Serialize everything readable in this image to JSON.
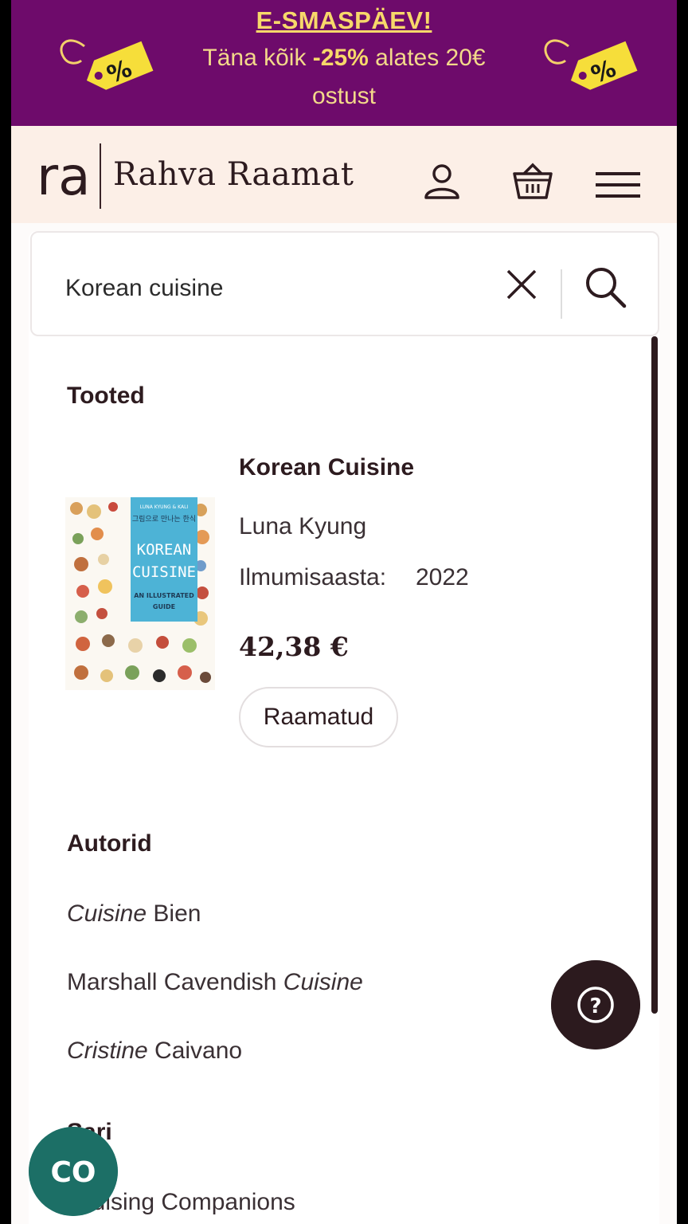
{
  "promo": {
    "title": "E-SMASPÄEV!",
    "line1_pre": "Täna kõik ",
    "line1_bold": "-25%",
    "line1_post": " alates 20€",
    "line2": "ostust",
    "tag_symbol": "%"
  },
  "header": {
    "logo_mark": "ra",
    "logo_text": "Rahva Raamat",
    "icons": [
      "user-icon",
      "basket-icon",
      "menu-icon"
    ]
  },
  "search": {
    "value": "Korean cuisine",
    "placeholder": ""
  },
  "products": {
    "heading": "Tooted",
    "item": {
      "title": "Korean Cuisine",
      "author": "Luna Kyung",
      "year_label": "Ilmumisaasta:",
      "year": "2022",
      "price": "42,38 €",
      "category": "Raamatud",
      "cover": {
        "top_label": "LUNA KYUNG & KALI",
        "korean": "그림으로 만나는 한식",
        "title1": "KOREAN",
        "title2": "CUISINE",
        "sub1": "AN ILLUSTRATED",
        "sub2": "GUIDE"
      }
    }
  },
  "authors": {
    "heading": "Autorid",
    "items": [
      {
        "pre": "",
        "em": "Cuisine",
        "post": " Bien"
      },
      {
        "pre": "Marshall Cavendish ",
        "em": "Cuisine",
        "post": ""
      },
      {
        "pre": "",
        "em": "Cristine",
        "post": " Caivano"
      }
    ]
  },
  "series": {
    "heading": "Sari",
    "items": [
      "Cruising Companions"
    ]
  },
  "floating": {
    "help_symbol": "?",
    "co_label": "CO"
  },
  "colors": {
    "promo_bg": "#6e0b6b",
    "promo_text": "#f7d86a",
    "header_bg": "#fcefe7",
    "brand_dark": "#2c1a1e",
    "co_button": "#1c6f66"
  }
}
